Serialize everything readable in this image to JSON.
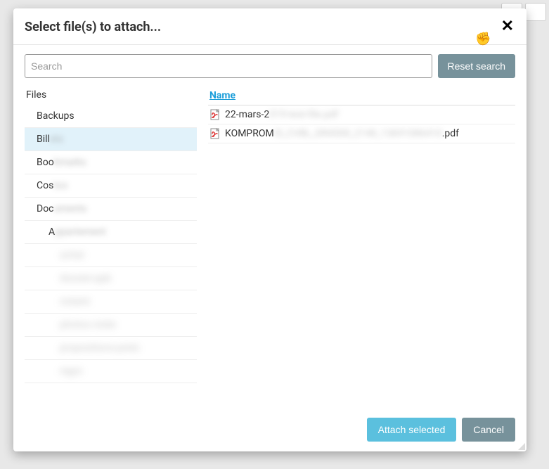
{
  "modal": {
    "title": "Select file(s) to attach..."
  },
  "search": {
    "placeholder": "Search",
    "value": "",
    "reset_label": "Reset search"
  },
  "sidebar": {
    "root": "Files",
    "items": [
      {
        "label": "Backups",
        "level": 1,
        "selected": false,
        "blur": "none",
        "blurred_part": ""
      },
      {
        "label": "Bill",
        "level": 1,
        "selected": true,
        "blur": "partial",
        "blurred_part": "ets"
      },
      {
        "label": "Boo",
        "level": 1,
        "selected": false,
        "blur": "partial",
        "blurred_part": "kmarks"
      },
      {
        "label": "Cos",
        "level": 1,
        "selected": false,
        "blur": "partial",
        "blurred_part": "tco"
      },
      {
        "label": "Doc",
        "level": 1,
        "selected": false,
        "blur": "partial",
        "blurred_part": "uments"
      },
      {
        "label": "A",
        "level": 2,
        "selected": false,
        "blur": "partial",
        "blurred_part": "ppartement"
      },
      {
        "label": "achat",
        "level": 3,
        "selected": false,
        "blur": "full",
        "blurred_part": ""
      },
      {
        "label": "dossier-ppb",
        "level": 3,
        "selected": false,
        "blur": "full",
        "blurred_part": ""
      },
      {
        "label": "notaire",
        "level": 3,
        "selected": false,
        "blur": "full",
        "blurred_part": ""
      },
      {
        "label": "photos-visite",
        "level": 3,
        "selected": false,
        "blur": "full",
        "blurred_part": ""
      },
      {
        "label": "propositions-prets",
        "level": 3,
        "selected": false,
        "blur": "full",
        "blurred_part": ""
      },
      {
        "label": "regro",
        "level": 3,
        "selected": false,
        "blur": "full",
        "blurred_part": ""
      }
    ]
  },
  "files": {
    "columns": {
      "name": "Name"
    },
    "rows": [
      {
        "prefix": "22-mars-2",
        "blurred": "019-test-file.pdf",
        "suffix": ""
      },
      {
        "prefix": "KOMPROM",
        "blurred": "IS_CVBL_DR4500_2140_13691086410",
        "suffix": ".pdf"
      }
    ]
  },
  "footer": {
    "attach_label": "Attach selected",
    "cancel_label": "Cancel"
  }
}
